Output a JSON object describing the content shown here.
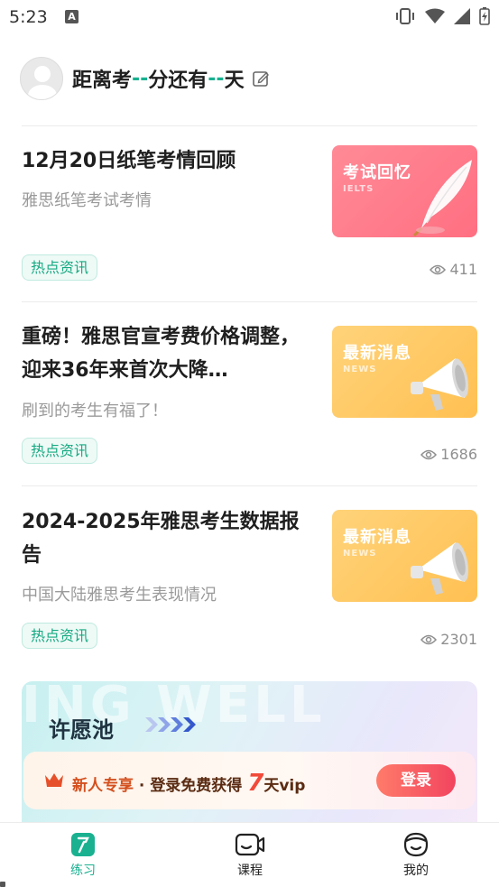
{
  "status_bar": {
    "time": "5:23",
    "notification_glyph": "A",
    "icons": [
      "vibrate-icon",
      "wifi-icon",
      "signal-icon",
      "battery-charging-icon"
    ]
  },
  "header": {
    "countdown_prefix": "距离考",
    "minutes_value": "--",
    "minutes_unit": "分还有",
    "days_value": "--",
    "days_unit": "天",
    "accent_color": "#19b190"
  },
  "articles": [
    {
      "title": "12月20日纸笔考情回顾",
      "subtitle": "雅思纸笔考试考情",
      "tag": "热点资讯",
      "views": "411",
      "thumb_title": "考试回忆",
      "thumb_en": "IELTS",
      "thumb_icon": "feather-quill-icon"
    },
    {
      "title": "重磅！雅思官宣考费价格调整，迎来36年来首次大降…",
      "subtitle": "刷到的考生有福了！",
      "tag": "热点资讯",
      "views": "1686",
      "thumb_title": "最新消息",
      "thumb_en": "NEWS",
      "thumb_icon": "megaphone-icon"
    },
    {
      "title": "2024-2025年雅思考生数据报告",
      "subtitle": "中国大陆雅思考生表现情况",
      "tag": "热点资讯",
      "views": "2301",
      "thumb_title": "最新消息",
      "thumb_en": "NEWS",
      "thumb_icon": "megaphone-icon"
    }
  ],
  "banner": {
    "bg_text": "ING WELL",
    "title": "许愿池",
    "promo_part1": "新人专享",
    "promo_dot": "·",
    "promo_part2": "登录免费获得",
    "promo_days_num": "7",
    "promo_days_unit": "天vip",
    "login_label": "登录"
  },
  "bottom_nav": {
    "items": [
      {
        "label": "练习",
        "icon": "practice-icon",
        "active": true
      },
      {
        "label": "课程",
        "icon": "course-video-icon",
        "active": false
      },
      {
        "label": "我的",
        "icon": "profile-face-icon",
        "active": false
      }
    ]
  }
}
